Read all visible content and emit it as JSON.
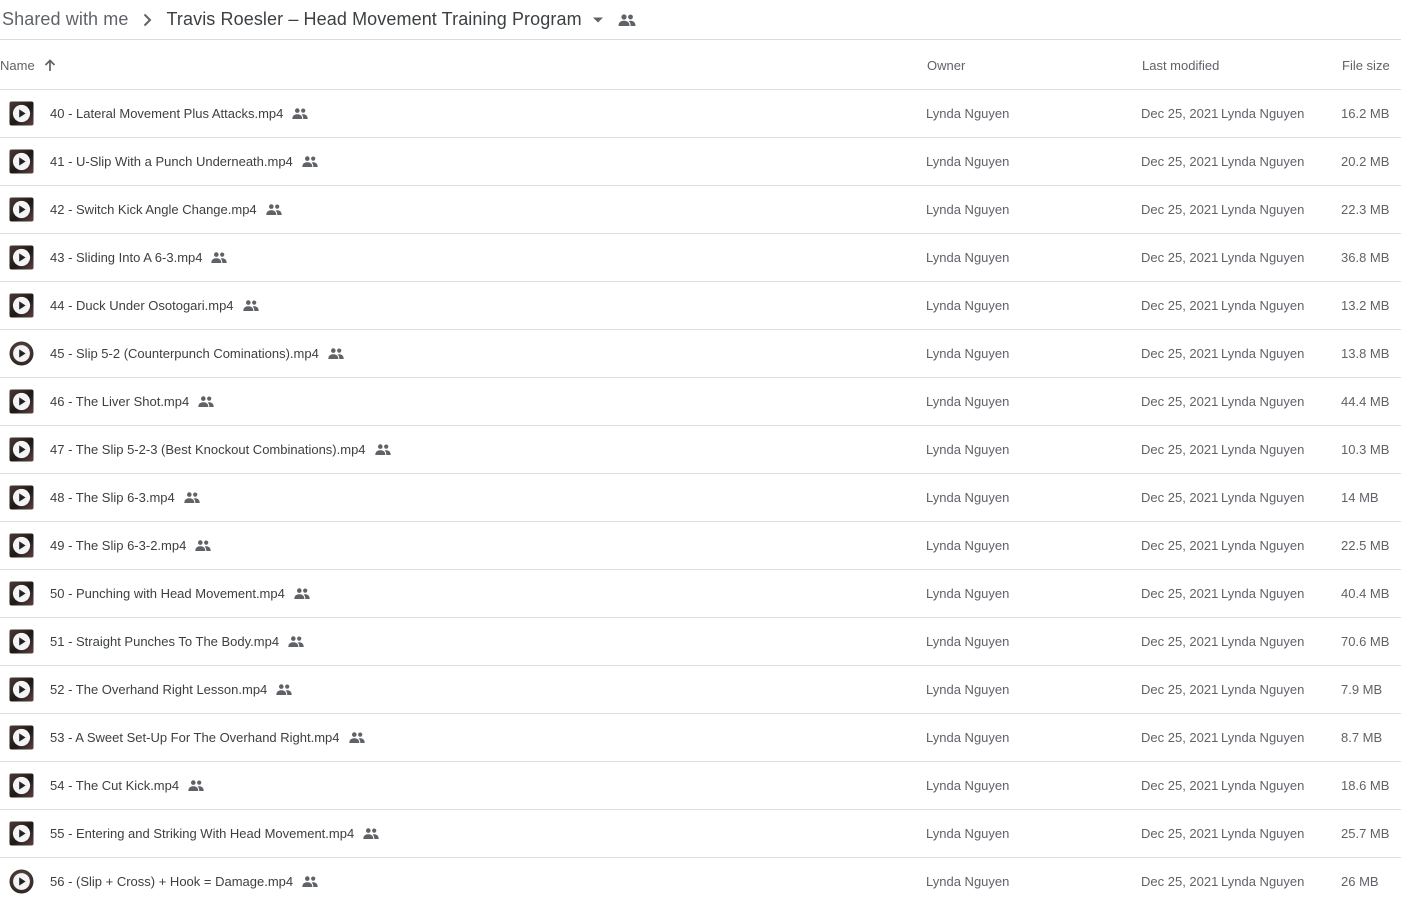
{
  "breadcrumb": {
    "root_label": "Shared with me",
    "separator_icon": "chevron-right-icon",
    "current_folder": "Travis Roesler – Head Movement Training Program",
    "dropdown_icon": "arrow-drop-down-icon",
    "shared_icon": "people-icon"
  },
  "columns": {
    "name": "Name",
    "owner": "Owner",
    "last_modified": "Last modified",
    "file_size": "File size",
    "sort_icon": "arrow-upward-icon",
    "sort_direction": "ascending"
  },
  "colors": {
    "text_primary": "#3c4043",
    "text_secondary": "#5f6368",
    "divider": "#dadce0"
  },
  "files": [
    {
      "name": "40 - Lateral Movement Plus Attacks.mp4",
      "owner": "Lynda Nguyen",
      "modified_date": "Dec 25, 2021",
      "modified_by": "Lynda Nguyen",
      "size": "16.2 MB",
      "thumb": "square"
    },
    {
      "name": "41 - U-Slip With a Punch Underneath.mp4",
      "owner": "Lynda Nguyen",
      "modified_date": "Dec 25, 2021",
      "modified_by": "Lynda Nguyen",
      "size": "20.2 MB",
      "thumb": "square"
    },
    {
      "name": "42 - Switch Kick Angle Change.mp4",
      "owner": "Lynda Nguyen",
      "modified_date": "Dec 25, 2021",
      "modified_by": "Lynda Nguyen",
      "size": "22.3 MB",
      "thumb": "square"
    },
    {
      "name": "43 - Sliding Into A 6-3.mp4",
      "owner": "Lynda Nguyen",
      "modified_date": "Dec 25, 2021",
      "modified_by": "Lynda Nguyen",
      "size": "36.8 MB",
      "thumb": "square"
    },
    {
      "name": "44 - Duck Under Osotogari.mp4",
      "owner": "Lynda Nguyen",
      "modified_date": "Dec 25, 2021",
      "modified_by": "Lynda Nguyen",
      "size": "13.2 MB",
      "thumb": "square"
    },
    {
      "name": "45 - Slip 5-2 (Counterpunch Cominations).mp4",
      "owner": "Lynda Nguyen",
      "modified_date": "Dec 25, 2021",
      "modified_by": "Lynda Nguyen",
      "size": "13.8 MB",
      "thumb": "circle"
    },
    {
      "name": "46 - The Liver Shot.mp4",
      "owner": "Lynda Nguyen",
      "modified_date": "Dec 25, 2021",
      "modified_by": "Lynda Nguyen",
      "size": "44.4 MB",
      "thumb": "square"
    },
    {
      "name": "47 - The Slip 5-2-3 (Best Knockout Combinations).mp4",
      "owner": "Lynda Nguyen",
      "modified_date": "Dec 25, 2021",
      "modified_by": "Lynda Nguyen",
      "size": "10.3 MB",
      "thumb": "square"
    },
    {
      "name": "48 - The Slip 6-3.mp4",
      "owner": "Lynda Nguyen",
      "modified_date": "Dec 25, 2021",
      "modified_by": "Lynda Nguyen",
      "size": "14 MB",
      "thumb": "square"
    },
    {
      "name": "49 - The Slip 6-3-2.mp4",
      "owner": "Lynda Nguyen",
      "modified_date": "Dec 25, 2021",
      "modified_by": "Lynda Nguyen",
      "size": "22.5 MB",
      "thumb": "square"
    },
    {
      "name": "50 - Punching with Head Movement.mp4",
      "owner": "Lynda Nguyen",
      "modified_date": "Dec 25, 2021",
      "modified_by": "Lynda Nguyen",
      "size": "40.4 MB",
      "thumb": "square"
    },
    {
      "name": "51 - Straight Punches To The Body.mp4",
      "owner": "Lynda Nguyen",
      "modified_date": "Dec 25, 2021",
      "modified_by": "Lynda Nguyen",
      "size": "70.6 MB",
      "thumb": "square"
    },
    {
      "name": "52 - The Overhand Right Lesson.mp4",
      "owner": "Lynda Nguyen",
      "modified_date": "Dec 25, 2021",
      "modified_by": "Lynda Nguyen",
      "size": "7.9 MB",
      "thumb": "square"
    },
    {
      "name": "53 - A Sweet Set-Up For The Overhand Right.mp4",
      "owner": "Lynda Nguyen",
      "modified_date": "Dec 25, 2021",
      "modified_by": "Lynda Nguyen",
      "size": "8.7 MB",
      "thumb": "square"
    },
    {
      "name": "54 - The Cut Kick.mp4",
      "owner": "Lynda Nguyen",
      "modified_date": "Dec 25, 2021",
      "modified_by": "Lynda Nguyen",
      "size": "18.6 MB",
      "thumb": "square"
    },
    {
      "name": "55 - Entering and Striking With Head Movement.mp4",
      "owner": "Lynda Nguyen",
      "modified_date": "Dec 25, 2021",
      "modified_by": "Lynda Nguyen",
      "size": "25.7 MB",
      "thumb": "square"
    },
    {
      "name": "56 - (Slip + Cross) + Hook = Damage.mp4",
      "owner": "Lynda Nguyen",
      "modified_date": "Dec 25, 2021",
      "modified_by": "Lynda Nguyen",
      "size": "26 MB",
      "thumb": "circle"
    }
  ]
}
